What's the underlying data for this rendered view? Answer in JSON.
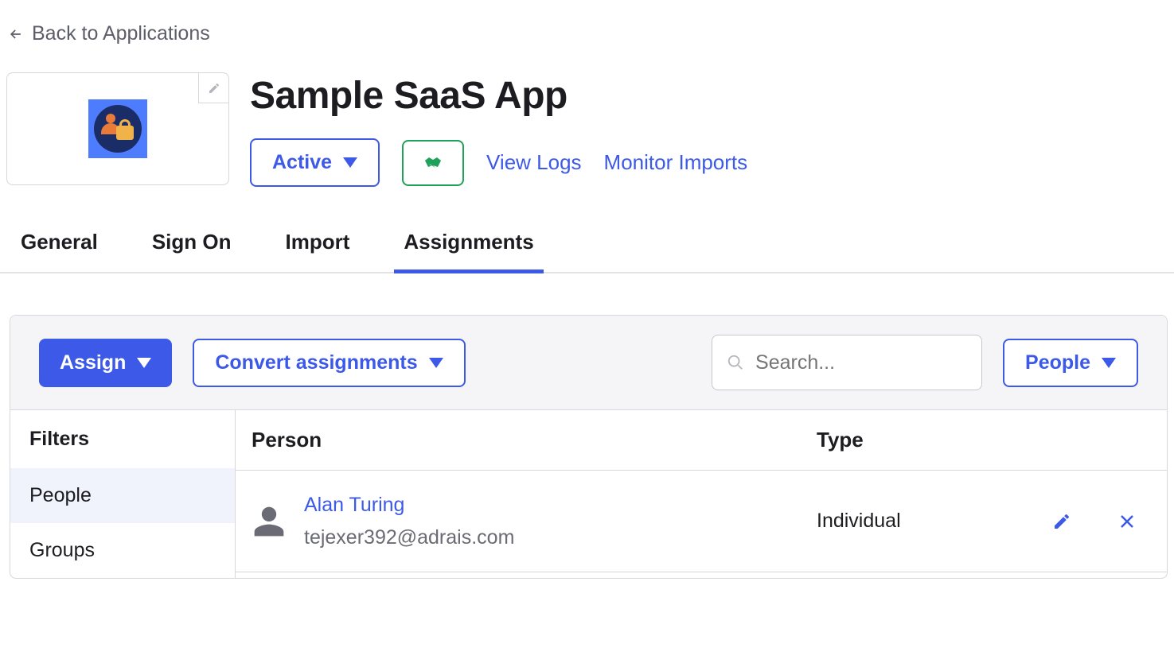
{
  "back_link_label": "Back to Applications",
  "app": {
    "title": "Sample SaaS App",
    "status_label": "Active",
    "view_logs_label": "View Logs",
    "monitor_imports_label": "Monitor Imports"
  },
  "tabs": {
    "general": "General",
    "sign_on": "Sign On",
    "import": "Import",
    "assignments": "Assignments"
  },
  "toolbar": {
    "assign_label": "Assign",
    "convert_label": "Convert assignments",
    "search_placeholder": "Search...",
    "scope_label": "People"
  },
  "filters": {
    "header": "Filters",
    "people": "People",
    "groups": "Groups"
  },
  "table": {
    "person_header": "Person",
    "type_header": "Type",
    "rows": [
      {
        "name": "Alan Turing",
        "email": "tejexer392@adrais.com",
        "type": "Individual"
      }
    ]
  }
}
